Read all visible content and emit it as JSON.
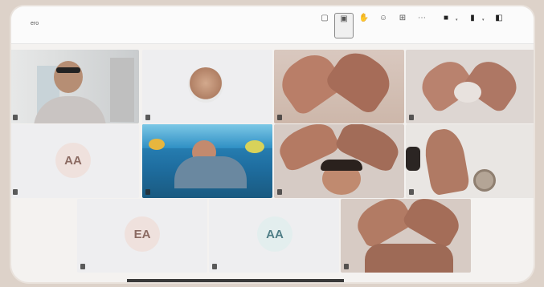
{
  "meeting": {
    "title_fragment": "ero"
  },
  "toolbar": [
    {
      "id": "chat",
      "icon": "chat-icon",
      "glyph": "▢",
      "label": ""
    },
    {
      "id": "view",
      "icon": "view-icon",
      "glyph": "▣",
      "label": "",
      "active": true
    },
    {
      "id": "raise",
      "icon": "raise-hand-icon",
      "glyph": "✋",
      "label": ""
    },
    {
      "id": "react",
      "icon": "react-icon",
      "glyph": "☺",
      "label": ""
    },
    {
      "id": "rooms",
      "icon": "rooms-icon",
      "glyph": "⊞",
      "label": ""
    },
    {
      "id": "more",
      "icon": "more-icon",
      "glyph": "⋯",
      "label": ""
    },
    {
      "id": "camera",
      "icon": "camera-icon",
      "glyph": "■",
      "label": ""
    },
    {
      "id": "mic",
      "icon": "mic-icon",
      "glyph": "▮",
      "label": ""
    },
    {
      "id": "share",
      "icon": "share-icon",
      "glyph": "◧",
      "label": ""
    }
  ],
  "participants": [
    {
      "name": "",
      "type": "video"
    },
    {
      "name": "",
      "type": "avatar-photo"
    },
    {
      "name": "",
      "type": "video"
    },
    {
      "name": "",
      "type": "video"
    },
    {
      "name": "",
      "type": "initials",
      "initials": "AA"
    },
    {
      "name": "",
      "type": "video"
    },
    {
      "name": "",
      "type": "video"
    },
    {
      "name": "",
      "type": "video"
    },
    {
      "name": "",
      "type": "initials",
      "initials": "EA"
    },
    {
      "name": "",
      "type": "initials",
      "initials": "AA"
    },
    {
      "name": "",
      "type": "video"
    }
  ]
}
